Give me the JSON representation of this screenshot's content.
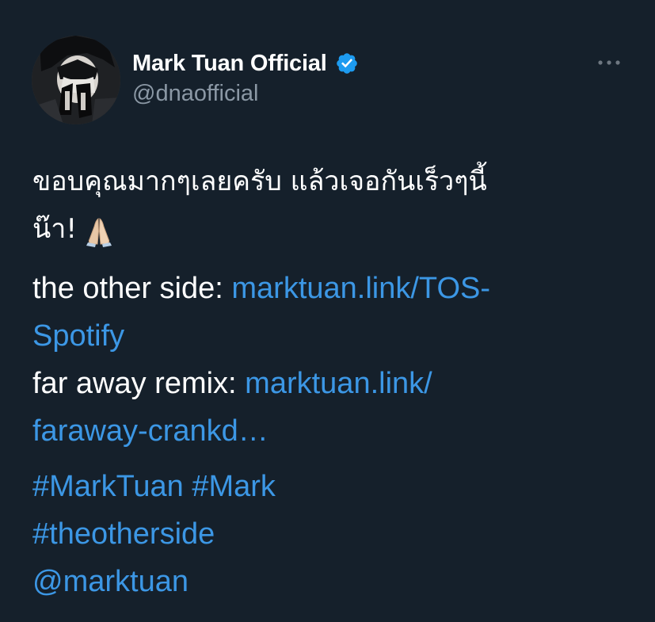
{
  "author": {
    "display_name": "Mark Tuan Official",
    "handle": "@dnaofficial",
    "verified": true,
    "verified_icon": "verified-badge-icon",
    "avatar_icon": "profile-avatar"
  },
  "menu": {
    "more_icon": "more-options-icon"
  },
  "tweet": {
    "thai_line1": "ขอบคุณมากๆเลยครับ แล้วเจอกันเร็วๆนี้",
    "thai_line2": "น๊า!",
    "emoji": "folded-hands-emoji",
    "link1_label": "the other side: ",
    "link1_part1": "marktuan.link/TOS-",
    "link1_part2": "Spotify",
    "link2_label": "far away remix: ",
    "link2_part1": "marktuan.link/",
    "link2_part2": "faraway-crankd…",
    "hashtag1": "#MarkTuan",
    "hashtag2": "#Mark",
    "hashtag3": "#theotherside",
    "mention": "@marktuan"
  },
  "colors": {
    "background": "#15202b",
    "text": "#ffffff",
    "secondary_text": "#8b98a5",
    "link": "#3c97e5",
    "verified": "#1d9bf0"
  }
}
